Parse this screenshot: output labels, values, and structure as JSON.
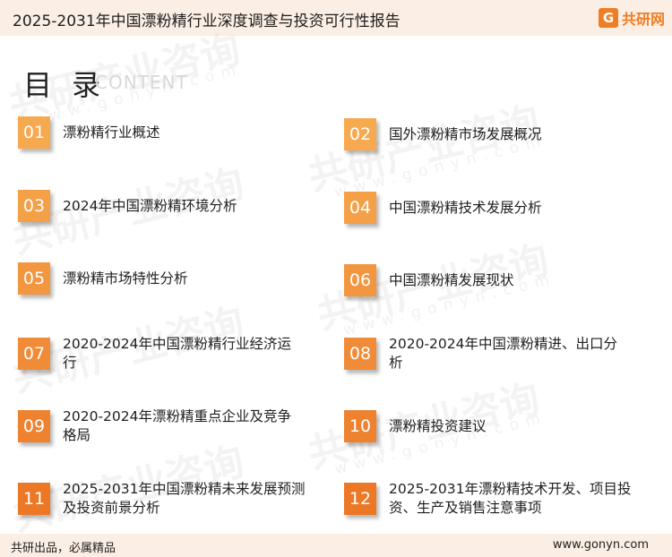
{
  "header": {
    "title": "2025-2031年中国漂粉精行业深度调查与投资可行性报告",
    "logo_mark": "G",
    "logo_text": "共研网"
  },
  "toc": {
    "title": "目 录",
    "subtitle": "CONTENT"
  },
  "watermark": {
    "text": "共研产业咨询",
    "sub": "www.gonyn.com"
  },
  "items": [
    {
      "num": "01",
      "label": "漂粉精行业概述"
    },
    {
      "num": "02",
      "label": "国外漂粉精市场发展概况"
    },
    {
      "num": "03",
      "label": "2024年中国漂粉精环境分析"
    },
    {
      "num": "04",
      "label": "中国漂粉精技术发展分析"
    },
    {
      "num": "05",
      "label": "漂粉精市场特性分析"
    },
    {
      "num": "06",
      "label": "中国漂粉精发展现状"
    },
    {
      "num": "07",
      "label": "2020-2024年中国漂粉精行业经济运行"
    },
    {
      "num": "08",
      "label": "2020-2024年中国漂粉精进、出口分析"
    },
    {
      "num": "09",
      "label": "2020-2024年漂粉精重点企业及竞争格局"
    },
    {
      "num": "10",
      "label": "漂粉精投资建议"
    },
    {
      "num": "11",
      "label": "2025-2031年中国漂粉精未来发展预测及投资前景分析"
    },
    {
      "num": "12",
      "label": "2025-2031年漂粉精技术开发、项目投资、生产及销售注意事项"
    }
  ],
  "colors": {
    "accent_light": "#f6a94f",
    "accent_dark": "#ec7325",
    "header_bg": "#fbeee4"
  },
  "footer": {
    "left": "共研出品，必属精品",
    "right": "www.gonyn.com"
  }
}
